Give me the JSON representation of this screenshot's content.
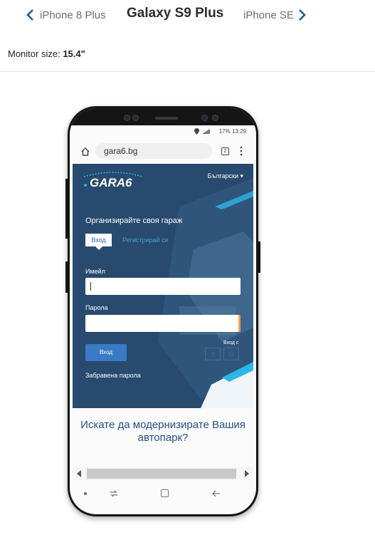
{
  "nav": {
    "prev_label": "iPhone 8 Plus",
    "title": "Galaxy S9 Plus",
    "next_label": "iPhone SE"
  },
  "monitor": {
    "label": "Monitor size:",
    "value": "15.4\""
  },
  "device": {
    "status_bar": "17% 13:29",
    "url": "gara6.bg",
    "tab_count": "2",
    "site": {
      "logo_text": "GARA6",
      "language": "Български ▾",
      "headline": "Организирайте своя гараж",
      "tab_login": "Вход",
      "tab_register": "Регистрирай се",
      "email_label": "Имейл",
      "password_label": "Парола",
      "login_button": "Вход",
      "login_with": "Вход с",
      "facebook": "f",
      "google": "G",
      "forgot_password": "Забравена парола",
      "promo": "Искате да модернизирате Вашия автопарк?"
    }
  },
  "colors": {
    "hero_bg": "#274a6e",
    "accent": "#3a7bc4",
    "promo_text": "#274f85",
    "nav_chevron": "#1e5f8a"
  }
}
